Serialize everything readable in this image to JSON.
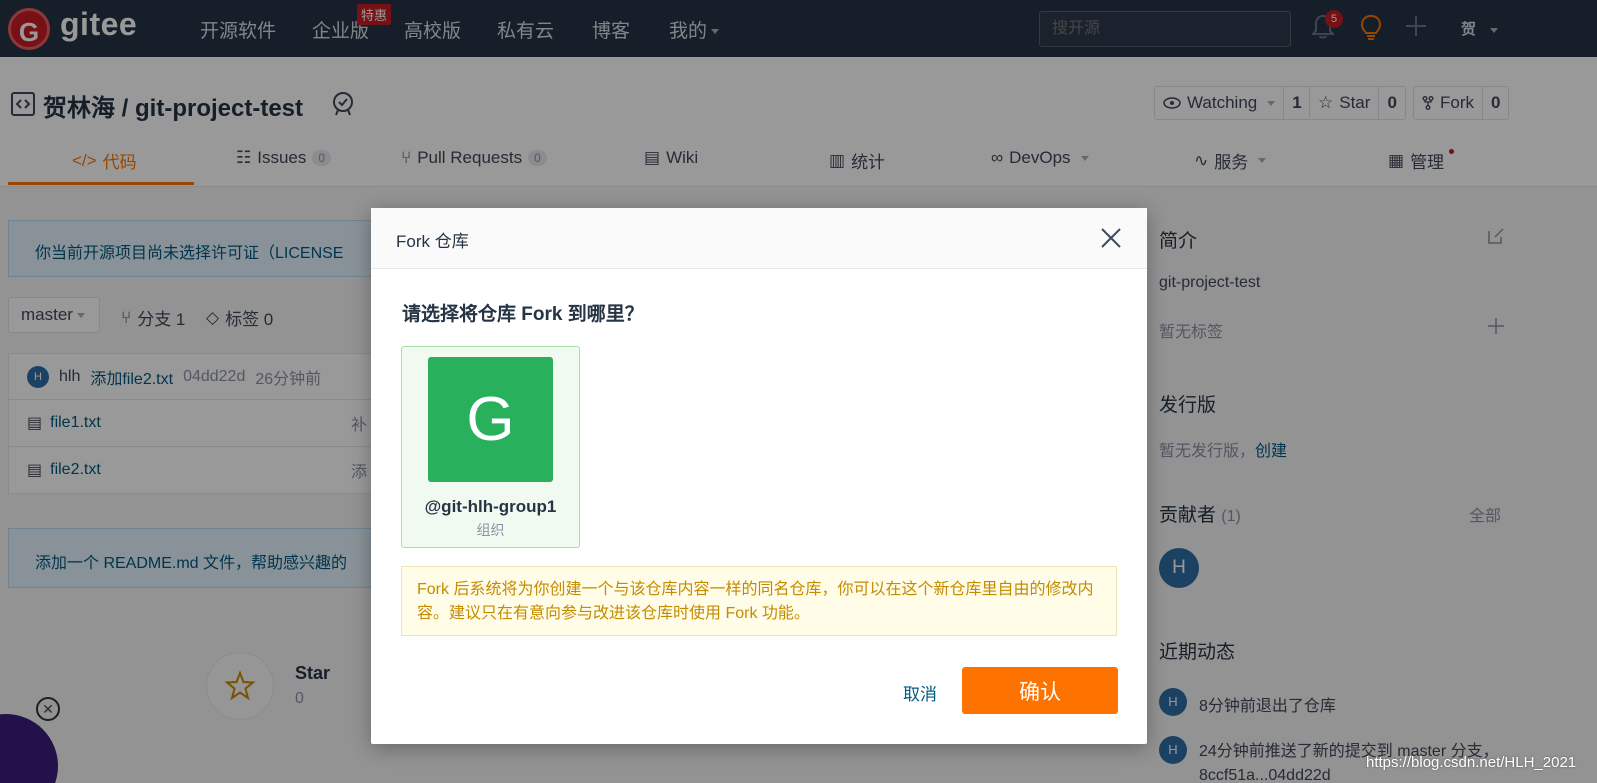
{
  "nav": {
    "logo_letter": "G",
    "brand": "gitee",
    "items": [
      "开源软件",
      "企业版",
      "高校版",
      "私有云",
      "博客",
      "我的"
    ],
    "enterprise_badge": "特惠",
    "search_placeholder": "搜开源",
    "notification_count": "5",
    "user_initial": "贺"
  },
  "repo": {
    "title": "贺林海 / git-project-test",
    "watch_label": "Watching",
    "watch_count": "1",
    "star_label": "Star",
    "star_count": "0",
    "fork_label": "Fork",
    "fork_count": "0",
    "tabs": [
      {
        "label": "代码"
      },
      {
        "label": "Issues",
        "count": "0"
      },
      {
        "label": "Pull Requests",
        "count": "0"
      },
      {
        "label": "Wiki"
      },
      {
        "label": "统计"
      },
      {
        "label": "DevOps"
      },
      {
        "label": "服务"
      },
      {
        "label": "管理"
      }
    ]
  },
  "main": {
    "license_notice": "你当前开源项目尚未选择许可证（LICENSE",
    "branch": "master",
    "branches": "分支 1",
    "tags": "标签 0",
    "commit": {
      "avatar": "H",
      "author": "hlh",
      "message": "添加file2.txt",
      "hash": "04dd22d",
      "time": "26分钟前"
    },
    "files": [
      {
        "name": "file1.txt",
        "trail": "补"
      },
      {
        "name": "file2.txt",
        "trail": "添"
      }
    ],
    "readme_notice": "添加一个 README.md 文件，帮助感兴趣的",
    "star_title": "Star",
    "star_count": "0"
  },
  "sidebar": {
    "intro_title": "简介",
    "intro_text": "git-project-test",
    "no_tags": "暂无标签",
    "release_title": "发行版",
    "no_release": "暂无发行版，",
    "create_link": "创建",
    "contributors_title": "贡献者",
    "contributors_count": "(1)",
    "all_link": "全部",
    "contributor_avatar": "H",
    "activity_title": "近期动态",
    "activities": [
      {
        "avatar": "H",
        "text": "8分钟前退出了仓库"
      },
      {
        "avatar": "H",
        "text": "24分钟前推送了新的提交到 master 分支，8ccf51a...04dd22d"
      }
    ]
  },
  "modal": {
    "title": "Fork 仓库",
    "question": "请选择将仓库 Fork 到哪里？",
    "org": {
      "avatar_letter": "G",
      "name": "@git-hlh-group1",
      "type": "组织",
      "color": "#28b05c"
    },
    "notice": "Fork 后系统将为你创建一个与该仓库内容一样的同名仓库，你可以在这个新仓库里自由的修改内容。建议只在有意向参与改进该仓库时使用 Fork 功能。",
    "cancel": "取消",
    "confirm": "确认",
    "confirm_color": "#fe7300"
  },
  "watermark": "https://blog.csdn.net/HLH_2021"
}
